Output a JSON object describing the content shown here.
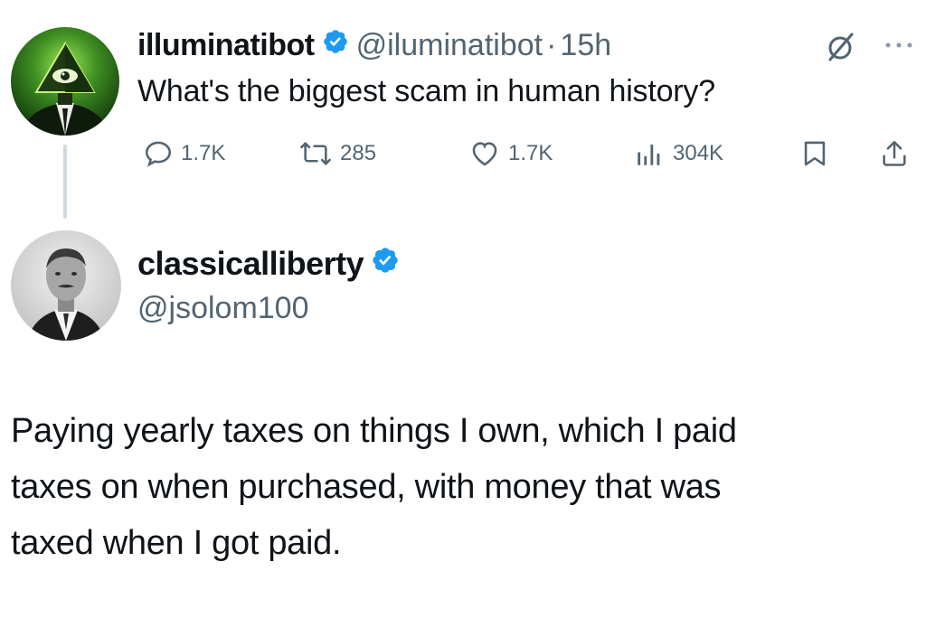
{
  "tweet1": {
    "display_name": "illuminatibot",
    "handle": "@iluminatibot",
    "separator": "·",
    "time": "15h",
    "text": "What's the biggest scam in human history?",
    "avatar_icon": "illuminati-eye-pyramid-icon",
    "actions": {
      "replies": "1.7K",
      "reposts": "285",
      "likes": "1.7K",
      "views": "304K"
    }
  },
  "tweet2": {
    "display_name": "classicalliberty",
    "handle": "@jsolom100",
    "avatar_icon": "portrait-avatar",
    "text_lines": [
      "Paying yearly taxes on things I own, which I paid",
      "taxes on when purchased, with money that was",
      "taxed when I got paid."
    ]
  },
  "colors": {
    "verified_blue": "#1d9bf0",
    "secondary_text": "#536471",
    "avatar1_bg": "#2d6b1f"
  }
}
